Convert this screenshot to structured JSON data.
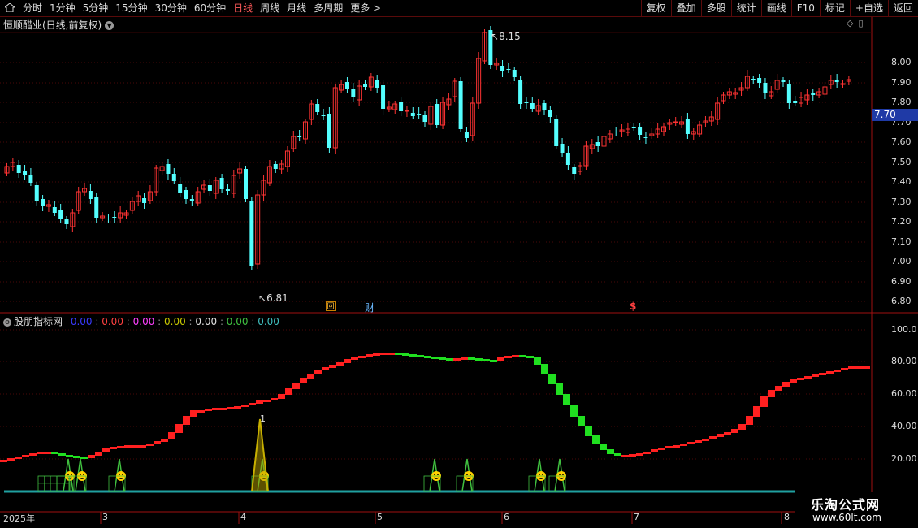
{
  "toolbar": {
    "home_icon": "home-icon",
    "periods": [
      "分时",
      "1分钟",
      "5分钟",
      "15分钟",
      "30分钟",
      "60分钟",
      "日线",
      "周线",
      "月线",
      "多周期",
      "更多 >"
    ],
    "active_period": "日线",
    "right_buttons": [
      "复权",
      "叠加",
      "多股",
      "统计",
      "画线",
      "F10",
      "标记",
      "+自选",
      "返回"
    ]
  },
  "main_chart": {
    "title": "恒顺醋业(日线,前复权)",
    "high_label": "8.15",
    "low_label": "6.81",
    "current_price_tag": "7.70",
    "event_markers": [
      "回",
      "财",
      "$"
    ],
    "price_axis": [
      "8.00",
      "7.90",
      "7.80",
      "7.70",
      "7.60",
      "7.50",
      "7.40",
      "7.30",
      "7.20",
      "7.10",
      "7.00",
      "6.90",
      "6.80"
    ]
  },
  "indicator": {
    "name": "股朋指标网",
    "values": [
      "0.00",
      "0.00",
      "0.00",
      "0.00",
      "0.00",
      "0.00",
      "0.00"
    ],
    "value_colors": [
      "#3a3aff",
      "#ff4040",
      "#ff40ff",
      "#c8c800",
      "#e0e0e0",
      "#40c040",
      "#40c0c0"
    ],
    "axis": [
      "100.0",
      "80.00",
      "60.00",
      "40.00",
      "20.00"
    ],
    "peak_label": "1"
  },
  "date_axis": [
    "2025年",
    "3",
    "4",
    "5",
    "6",
    "7",
    "8"
  ],
  "watermark": {
    "site_name": "乐淘公式网",
    "url": "www.60lt.com"
  },
  "colors": {
    "up": "#ff3333",
    "down": "#54ffff",
    "bg": "#000000",
    "grid": "#5a0a0a"
  }
}
